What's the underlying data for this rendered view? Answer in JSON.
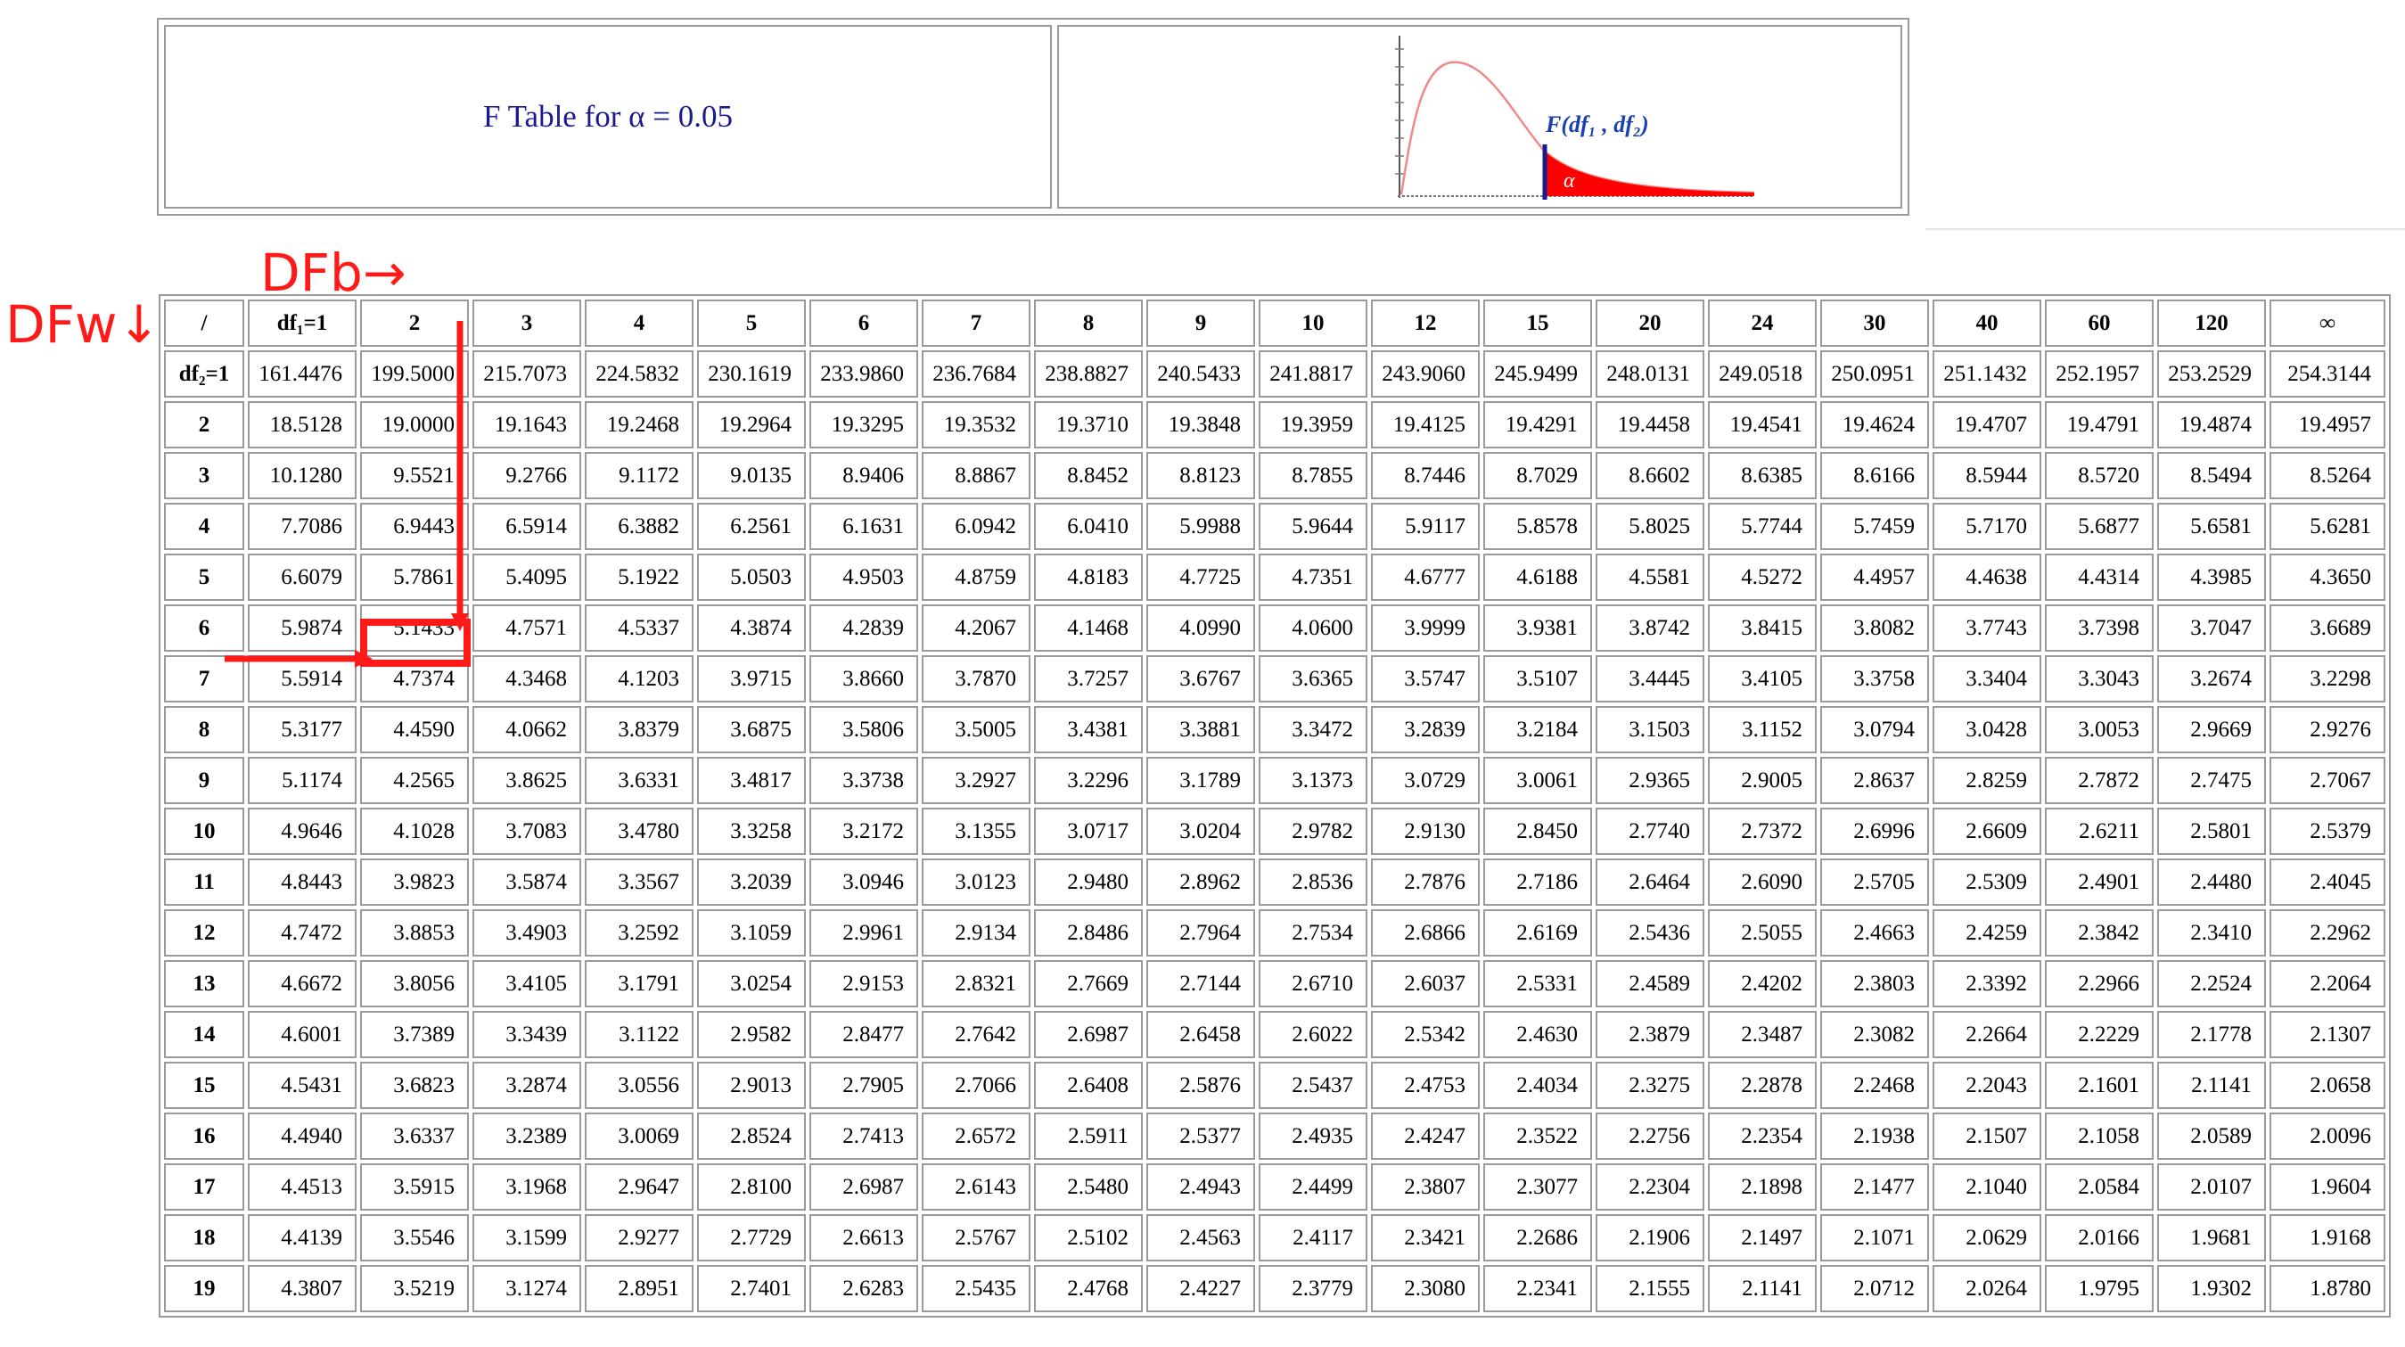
{
  "header": {
    "title": "F Table for α = 0.05",
    "graph_label": "F(df₁ , df₂)",
    "alpha_label": "α"
  },
  "annotations": {
    "dfb": "DFb→",
    "dfw": "DFw↓",
    "highlight_color": "#ff1a1a"
  },
  "table": {
    "corner": "/",
    "col_headers": [
      "df₁=1",
      "2",
      "3",
      "4",
      "5",
      "6",
      "7",
      "8",
      "9",
      "10",
      "12",
      "15",
      "20",
      "24",
      "30",
      "40",
      "60",
      "120",
      "∞"
    ],
    "rows": [
      {
        "df2": "df₂=1",
        "values": [
          "161.4476",
          "199.5000",
          "215.7073",
          "224.5832",
          "230.1619",
          "233.9860",
          "236.7684",
          "238.8827",
          "240.5433",
          "241.8817",
          "243.9060",
          "245.9499",
          "248.0131",
          "249.0518",
          "250.0951",
          "251.1432",
          "252.1957",
          "253.2529",
          "254.3144"
        ]
      },
      {
        "df2": "2",
        "values": [
          "18.5128",
          "19.0000",
          "19.1643",
          "19.2468",
          "19.2964",
          "19.3295",
          "19.3532",
          "19.3710",
          "19.3848",
          "19.3959",
          "19.4125",
          "19.4291",
          "19.4458",
          "19.4541",
          "19.4624",
          "19.4707",
          "19.4791",
          "19.4874",
          "19.4957"
        ]
      },
      {
        "df2": "3",
        "values": [
          "10.1280",
          "9.5521",
          "9.2766",
          "9.1172",
          "9.0135",
          "8.9406",
          "8.8867",
          "8.8452",
          "8.8123",
          "8.7855",
          "8.7446",
          "8.7029",
          "8.6602",
          "8.6385",
          "8.6166",
          "8.5944",
          "8.5720",
          "8.5494",
          "8.5264"
        ]
      },
      {
        "df2": "4",
        "values": [
          "7.7086",
          "6.9443",
          "6.5914",
          "6.3882",
          "6.2561",
          "6.1631",
          "6.0942",
          "6.0410",
          "5.9988",
          "5.9644",
          "5.9117",
          "5.8578",
          "5.8025",
          "5.7744",
          "5.7459",
          "5.7170",
          "5.6877",
          "5.6581",
          "5.6281"
        ]
      },
      {
        "df2": "5",
        "values": [
          "6.6079",
          "5.7861",
          "5.4095",
          "5.1922",
          "5.0503",
          "4.9503",
          "4.8759",
          "4.8183",
          "4.7725",
          "4.7351",
          "4.6777",
          "4.6188",
          "4.5581",
          "4.5272",
          "4.4957",
          "4.4638",
          "4.4314",
          "4.3985",
          "4.3650"
        ]
      },
      {
        "df2": "6",
        "values": [
          "5.9874",
          "5.1433",
          "4.7571",
          "4.5337",
          "4.3874",
          "4.2839",
          "4.2067",
          "4.1468",
          "4.0990",
          "4.0600",
          "3.9999",
          "3.9381",
          "3.8742",
          "3.8415",
          "3.8082",
          "3.7743",
          "3.7398",
          "3.7047",
          "3.6689"
        ]
      },
      {
        "df2": "7",
        "values": [
          "5.5914",
          "4.7374",
          "4.3468",
          "4.1203",
          "3.9715",
          "3.8660",
          "3.7870",
          "3.7257",
          "3.6767",
          "3.6365",
          "3.5747",
          "3.5107",
          "3.4445",
          "3.4105",
          "3.3758",
          "3.3404",
          "3.3043",
          "3.2674",
          "3.2298"
        ]
      },
      {
        "df2": "8",
        "values": [
          "5.3177",
          "4.4590",
          "4.0662",
          "3.8379",
          "3.6875",
          "3.5806",
          "3.5005",
          "3.4381",
          "3.3881",
          "3.3472",
          "3.2839",
          "3.2184",
          "3.1503",
          "3.1152",
          "3.0794",
          "3.0428",
          "3.0053",
          "2.9669",
          "2.9276"
        ]
      },
      {
        "df2": "9",
        "values": [
          "5.1174",
          "4.2565",
          "3.8625",
          "3.6331",
          "3.4817",
          "3.3738",
          "3.2927",
          "3.2296",
          "3.1789",
          "3.1373",
          "3.0729",
          "3.0061",
          "2.9365",
          "2.9005",
          "2.8637",
          "2.8259",
          "2.7872",
          "2.7475",
          "2.7067"
        ]
      },
      {
        "df2": "10",
        "values": [
          "4.9646",
          "4.1028",
          "3.7083",
          "3.4780",
          "3.3258",
          "3.2172",
          "3.1355",
          "3.0717",
          "3.0204",
          "2.9782",
          "2.9130",
          "2.8450",
          "2.7740",
          "2.7372",
          "2.6996",
          "2.6609",
          "2.6211",
          "2.5801",
          "2.5379"
        ]
      },
      {
        "df2": "11",
        "values": [
          "4.8443",
          "3.9823",
          "3.5874",
          "3.3567",
          "3.2039",
          "3.0946",
          "3.0123",
          "2.9480",
          "2.8962",
          "2.8536",
          "2.7876",
          "2.7186",
          "2.6464",
          "2.6090",
          "2.5705",
          "2.5309",
          "2.4901",
          "2.4480",
          "2.4045"
        ]
      },
      {
        "df2": "12",
        "values": [
          "4.7472",
          "3.8853",
          "3.4903",
          "3.2592",
          "3.1059",
          "2.9961",
          "2.9134",
          "2.8486",
          "2.7964",
          "2.7534",
          "2.6866",
          "2.6169",
          "2.5436",
          "2.5055",
          "2.4663",
          "2.4259",
          "2.3842",
          "2.3410",
          "2.2962"
        ]
      },
      {
        "df2": "13",
        "values": [
          "4.6672",
          "3.8056",
          "3.4105",
          "3.1791",
          "3.0254",
          "2.9153",
          "2.8321",
          "2.7669",
          "2.7144",
          "2.6710",
          "2.6037",
          "2.5331",
          "2.4589",
          "2.4202",
          "2.3803",
          "2.3392",
          "2.2966",
          "2.2524",
          "2.2064"
        ]
      },
      {
        "df2": "14",
        "values": [
          "4.6001",
          "3.7389",
          "3.3439",
          "3.1122",
          "2.9582",
          "2.8477",
          "2.7642",
          "2.6987",
          "2.6458",
          "2.6022",
          "2.5342",
          "2.4630",
          "2.3879",
          "2.3487",
          "2.3082",
          "2.2664",
          "2.2229",
          "2.1778",
          "2.1307"
        ]
      },
      {
        "df2": "15",
        "values": [
          "4.5431",
          "3.6823",
          "3.2874",
          "3.0556",
          "2.9013",
          "2.7905",
          "2.7066",
          "2.6408",
          "2.5876",
          "2.5437",
          "2.4753",
          "2.4034",
          "2.3275",
          "2.2878",
          "2.2468",
          "2.2043",
          "2.1601",
          "2.1141",
          "2.0658"
        ]
      },
      {
        "df2": "16",
        "values": [
          "4.4940",
          "3.6337",
          "3.2389",
          "3.0069",
          "2.8524",
          "2.7413",
          "2.6572",
          "2.5911",
          "2.5377",
          "2.4935",
          "2.4247",
          "2.3522",
          "2.2756",
          "2.2354",
          "2.1938",
          "2.1507",
          "2.1058",
          "2.0589",
          "2.0096"
        ]
      },
      {
        "df2": "17",
        "values": [
          "4.4513",
          "3.5915",
          "3.1968",
          "2.9647",
          "2.8100",
          "2.6987",
          "2.6143",
          "2.5480",
          "2.4943",
          "2.4499",
          "2.3807",
          "2.3077",
          "2.2304",
          "2.1898",
          "2.1477",
          "2.1040",
          "2.0584",
          "2.0107",
          "1.9604"
        ]
      },
      {
        "df2": "18",
        "values": [
          "4.4139",
          "3.5546",
          "3.1599",
          "2.9277",
          "2.7729",
          "2.6613",
          "2.5767",
          "2.5102",
          "2.4563",
          "2.4117",
          "2.3421",
          "2.2686",
          "2.1906",
          "2.1497",
          "2.1071",
          "2.0629",
          "2.0166",
          "1.9681",
          "1.9168"
        ]
      },
      {
        "df2": "19",
        "values": [
          "4.3807",
          "3.5219",
          "3.1274",
          "2.8951",
          "2.7401",
          "2.6283",
          "2.5435",
          "2.4768",
          "2.4227",
          "2.3779",
          "2.3080",
          "2.2341",
          "2.1555",
          "2.1141",
          "2.0712",
          "2.0264",
          "1.9795",
          "1.9302",
          "1.8780"
        ]
      }
    ]
  }
}
